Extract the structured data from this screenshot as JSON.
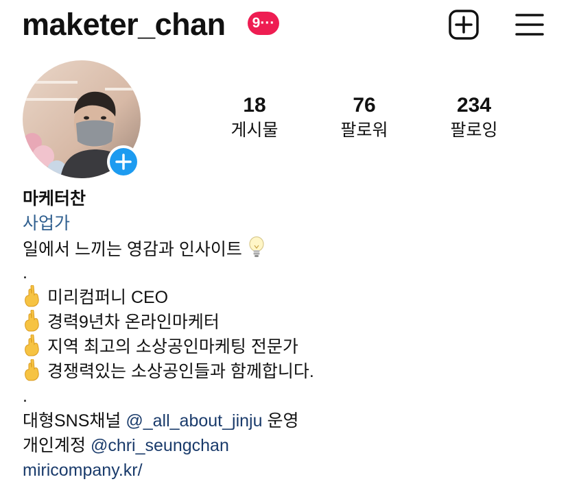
{
  "header": {
    "username": "maketer_chan",
    "notification_badge": "9···",
    "badge_color": "#ee1d52",
    "new_post_icon": "plus-square-icon",
    "menu_icon": "hamburger-menu-icon"
  },
  "avatar": {
    "add_story_icon": "plus-circle-icon",
    "add_story_color": "#1d9bf0"
  },
  "stats": [
    {
      "count": "18",
      "label": "게시물"
    },
    {
      "count": "76",
      "label": "팔로워"
    },
    {
      "count": "234",
      "label": "팔로잉"
    }
  ],
  "bio": {
    "display_name": "마케터찬",
    "category": "사업가",
    "intro": "일에서 느끼는 영감과 인사이트",
    "intro_icon": "lightbulb-icon",
    "separator1": ".",
    "bullet_icon": "crossed-fingers-icon",
    "bullets": [
      "미리컴퍼니 CEO",
      "경력9년차 온라인마케터",
      "지역 최고의 소상공인마케팅 전문가",
      "경쟁력있는 소상공인들과 함께합니다."
    ],
    "separator2": ".",
    "channel_prefix": "대형SNS채널 ",
    "channel_handle": "@_all_about_jinju",
    "channel_suffix": " 운영",
    "personal_prefix": "개인계정 ",
    "personal_handle": "@chri_seungchan",
    "website": "miricompany.kr/"
  }
}
